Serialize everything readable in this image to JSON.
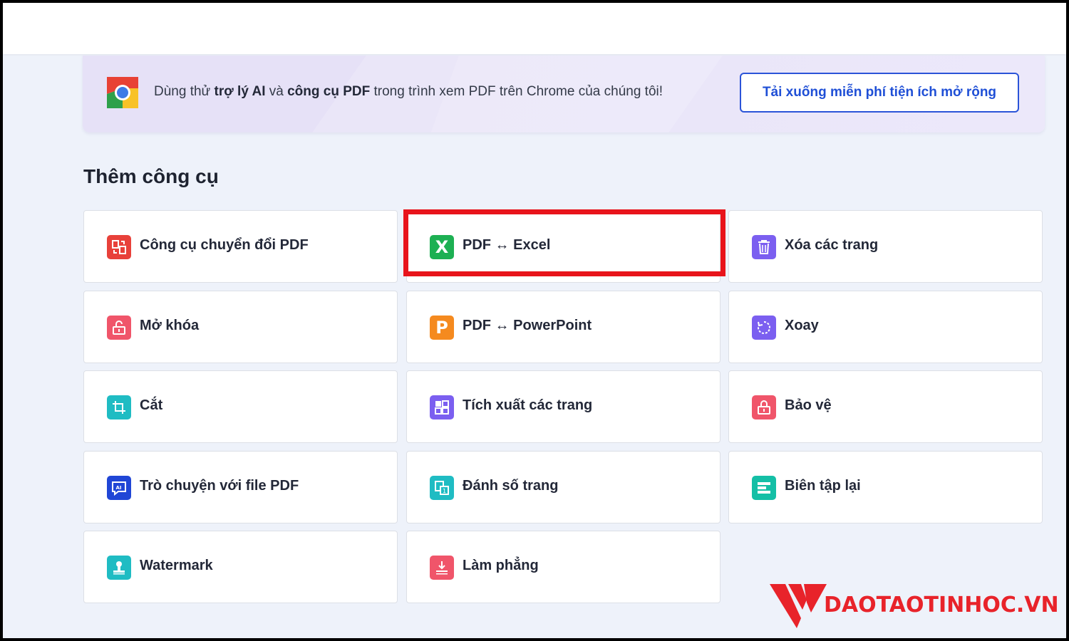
{
  "promo": {
    "text_before": "Dùng thử ",
    "bold_1": "trợ lý AI",
    "text_mid": " và ",
    "bold_2": "công cụ PDF",
    "text_after": " trong trình xem PDF trên Chrome của chúng tôi!",
    "button_label": "Tải xuống miễn phí tiện ích mở rộng"
  },
  "section": {
    "title": "Thêm công cụ"
  },
  "tools": [
    {
      "label": "Công cụ chuyển đổi PDF",
      "icon": "convert-icon",
      "color": "#e8413a"
    },
    {
      "label": "PDF ↔ Excel",
      "icon": "excel-icon",
      "color": "#1db053"
    },
    {
      "label": "Xóa các trang",
      "icon": "trash-icon",
      "color": "#7b5ff0"
    },
    {
      "label": "Mở khóa",
      "icon": "unlock-icon",
      "color": "#f0556a"
    },
    {
      "label": "PDF ↔ PowerPoint",
      "icon": "powerpoint-icon",
      "color": "#f58a1f"
    },
    {
      "label": "Xoay",
      "icon": "rotate-icon",
      "color": "#7b5ff0"
    },
    {
      "label": "Cắt",
      "icon": "crop-icon",
      "color": "#1fbcc3"
    },
    {
      "label": "Tích xuất các trang",
      "icon": "extract-icon",
      "color": "#7b5ff0"
    },
    {
      "label": "Bảo vệ",
      "icon": "lock-icon",
      "color": "#f0556a"
    },
    {
      "label": "Trò chuyện với file PDF",
      "icon": "ai-chat-icon",
      "color": "#2046d6"
    },
    {
      "label": "Đánh số trang",
      "icon": "page-number-icon",
      "color": "#1fbcc3"
    },
    {
      "label": "Biên tập lại",
      "icon": "redact-icon",
      "color": "#14bfa6"
    },
    {
      "label": "Watermark",
      "icon": "stamp-icon",
      "color": "#1fbcc3"
    },
    {
      "label": "Làm phẳng",
      "icon": "flatten-icon",
      "color": "#f0556a"
    }
  ],
  "watermark": {
    "text": "DAOTAOTINHOC.VN",
    "color": "#e8232a"
  }
}
